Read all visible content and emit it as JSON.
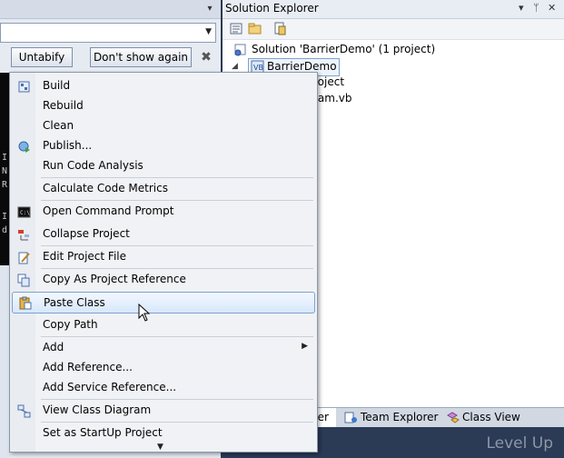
{
  "left_editor": {
    "buttons": {
      "untabify": "Untabify",
      "dont_show_again": "Don't show again",
      "close": "✖"
    },
    "dark_chars": [
      "I",
      "N",
      "R",
      "I",
      "d"
    ]
  },
  "solution_explorer": {
    "title": "Solution Explorer",
    "title_controls": {
      "pin": "▾",
      "autohide": "ᛘ",
      "close": "✕"
    },
    "solution_node": "Solution 'BarrierDemo' (1 project)",
    "project_node": "BarrierDemo",
    "child_items": [
      "roject",
      "ram.vb"
    ]
  },
  "bottom_tabs": [
    {
      "label": "rer",
      "icon": "solution-explorer-icon"
    },
    {
      "label": "Team Explorer",
      "icon": "team-explorer-icon"
    },
    {
      "label": "Class View",
      "icon": "class-view-icon"
    }
  ],
  "watermark": "Level Up",
  "context_menu": {
    "items": [
      {
        "label": "Build",
        "icon": "build-icon"
      },
      {
        "label": "Rebuild"
      },
      {
        "label": "Clean"
      },
      {
        "label": "Publish...",
        "icon": "publish-icon"
      },
      {
        "label": "Run Code Analysis"
      },
      {
        "label": "Calculate Code Metrics"
      },
      {
        "label": "Open Command Prompt",
        "icon": "command-prompt-icon"
      },
      {
        "label": "Collapse Project",
        "icon": "collapse-icon"
      },
      {
        "label": "Edit Project File",
        "icon": "edit-file-icon"
      },
      {
        "label": "Copy As Project Reference",
        "icon": "copy-reference-icon"
      },
      {
        "label": "Paste Class",
        "icon": "paste-class-icon",
        "selected": true
      },
      {
        "label": "Copy Path"
      },
      {
        "label": "Add",
        "submenu": true
      },
      {
        "label": "Add Reference..."
      },
      {
        "label": "Add Service Reference..."
      },
      {
        "label": "View Class Diagram",
        "icon": "class-diagram-icon"
      },
      {
        "label": "Set as StartUp Project"
      }
    ]
  },
  "colors": {
    "selection_border": "#7ca1d0",
    "selection_fill": "#d7e7fb",
    "chrome": "#2b3a55"
  }
}
